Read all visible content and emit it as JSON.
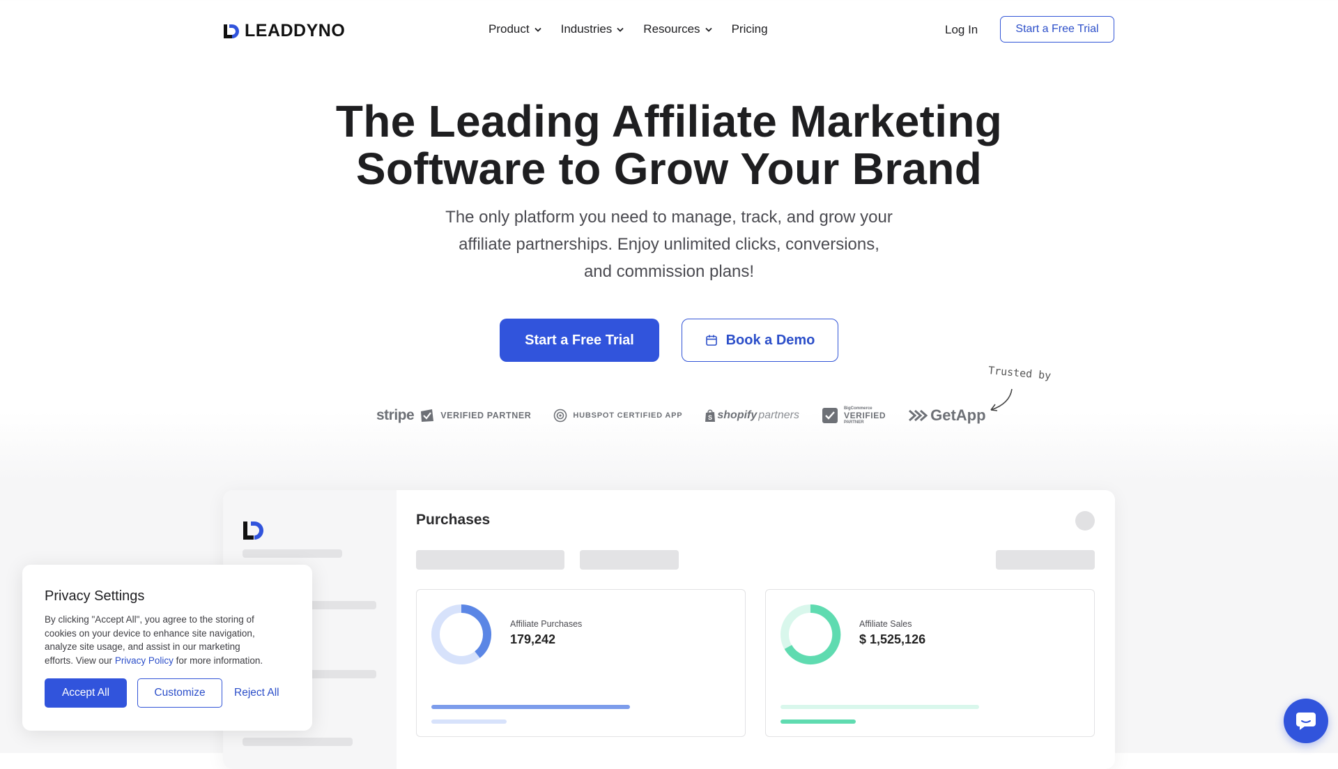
{
  "brand": {
    "name": "LEADDYNO",
    "accent": "#3154dc"
  },
  "nav": {
    "items": [
      {
        "label": "Product",
        "has_dropdown": true
      },
      {
        "label": "Industries",
        "has_dropdown": true
      },
      {
        "label": "Resources",
        "has_dropdown": true
      },
      {
        "label": "Pricing",
        "has_dropdown": false
      }
    ],
    "login": "Log In",
    "trial": "Start a Free Trial"
  },
  "hero": {
    "title_line1": "The Leading Affiliate Marketing",
    "title_line2": "Software to Grow Your Brand",
    "sub_line1": "The only platform you need to manage, track, and grow your",
    "sub_line2": "affiliate partnerships. Enjoy unlimited clicks, conversions,",
    "sub_line3": "and commission plans!",
    "cta_primary": "Start a Free Trial",
    "cta_secondary": "Book a Demo",
    "trusted": "Trusted by"
  },
  "partners": {
    "stripe_word": "stripe",
    "stripe_caption": "VERIFIED PARTNER",
    "hubspot_caption": "HUBSPOT CERTIFIED APP",
    "shopify_word": "shopify",
    "shopify_sub": "partners",
    "bigcommerce_small": "BigCommerce",
    "bigcommerce_big": "VERIFIED",
    "bigcommerce_small2": "PARTNER",
    "getapp_word": "GetApp"
  },
  "dashboard": {
    "title": "Purchases",
    "cards": [
      {
        "label": "Affiliate Purchases",
        "value": "179,242",
        "color": "#5b86e5",
        "light": "#d7e2fb"
      },
      {
        "label": "Affiliate Sales",
        "value": "$ 1,525,126",
        "color": "#5fdbb0",
        "light": "#d9f7ec"
      }
    ]
  },
  "privacy": {
    "title": "Privacy Settings",
    "body_line1": "By clicking \"Accept All\", you agree to the storing of",
    "body_line2": "cookies on your device to enhance site navigation,",
    "body_line3": "analyze site usage, and assist in our marketing",
    "body_line4a": "efforts. View our",
    "body_link": "Privacy Policy",
    "body_line4b": "for more information.",
    "accept": "Accept All",
    "customize": "Customize",
    "reject": "Reject All"
  }
}
